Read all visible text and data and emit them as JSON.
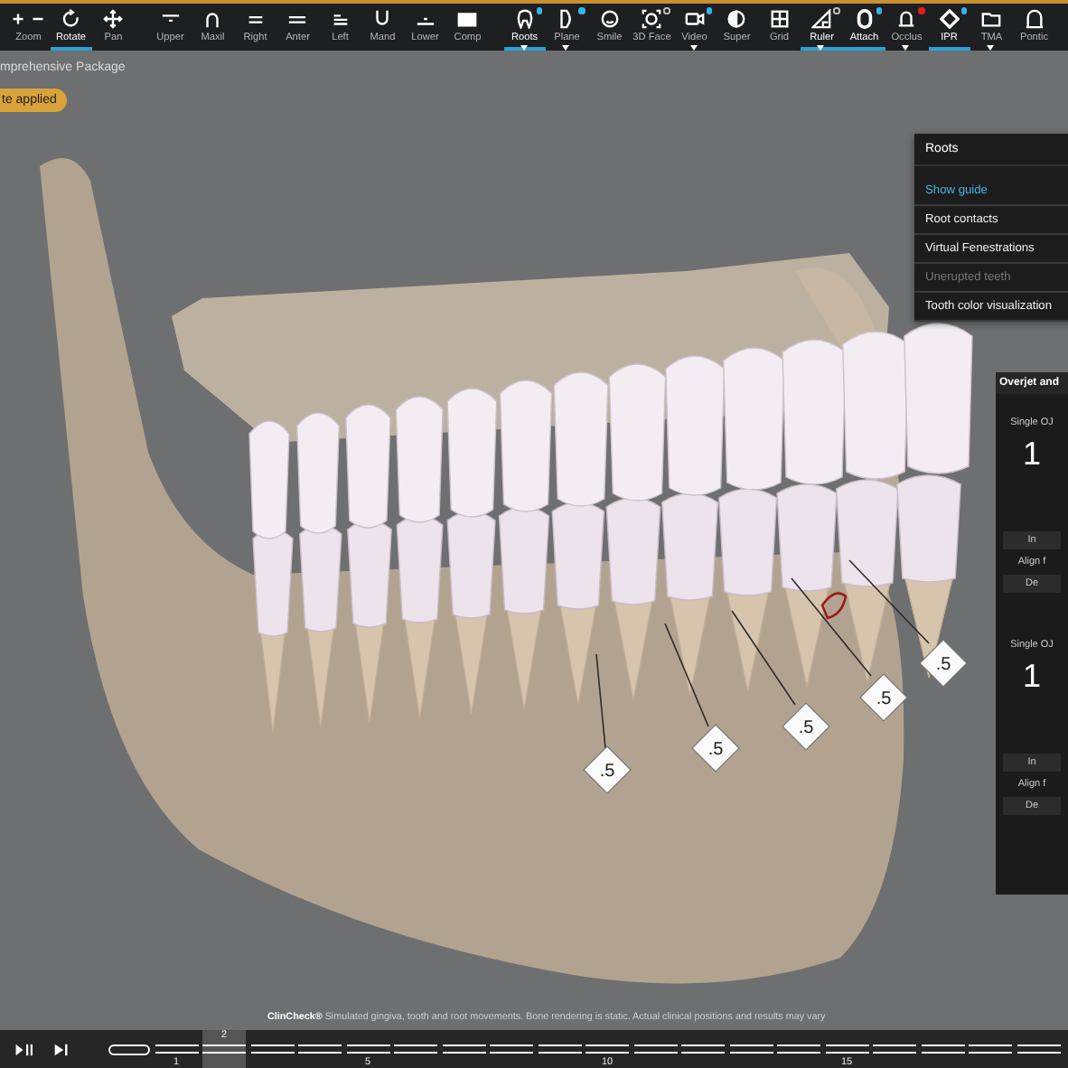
{
  "toolbar": {
    "groups": [
      [
        {
          "label": "Zoom",
          "selected": false
        },
        {
          "label": "Rotate",
          "selected": true
        },
        {
          "label": "Pan",
          "selected": false
        }
      ],
      [
        {
          "label": "Upper",
          "selected": false
        },
        {
          "label": "Maxil",
          "selected": false
        },
        {
          "label": "Right",
          "selected": false
        },
        {
          "label": "Anter",
          "selected": false
        },
        {
          "label": "Left",
          "selected": false
        },
        {
          "label": "Mand",
          "selected": false
        },
        {
          "label": "Lower",
          "selected": false
        },
        {
          "label": "Comp",
          "selected": false
        }
      ],
      [
        {
          "label": "Roots",
          "selected": true,
          "color": "#35b4e8",
          "hollow": false,
          "menu": true
        },
        {
          "label": "Plane",
          "selected": false,
          "color": "#35b4e8",
          "hollow": false,
          "menu": true
        },
        {
          "label": "Smile",
          "selected": false
        },
        {
          "label": "3D Face",
          "selected": false,
          "color": "#bbbbbb",
          "hollow": true
        },
        {
          "label": "Video",
          "selected": false,
          "color": "#35b4e8",
          "hollow": false,
          "menu": true
        },
        {
          "label": "Super",
          "selected": false
        },
        {
          "label": "Grid",
          "selected": false
        },
        {
          "label": "Ruler",
          "selected": true,
          "color": "#bbbbbb",
          "hollow": true,
          "menu": true
        },
        {
          "label": "Attach",
          "selected": true,
          "color": "#35b4e8",
          "hollow": false
        },
        {
          "label": "Occlus",
          "selected": false,
          "color": "#e02020",
          "hollow": false,
          "menu": true
        },
        {
          "label": "IPR",
          "selected": true,
          "color": "#35b4e8",
          "hollow": false
        },
        {
          "label": "TMA",
          "selected": false,
          "menu": true
        },
        {
          "label": "Pontic",
          "selected": false
        }
      ]
    ]
  },
  "header": {
    "title": "mprehensive Package",
    "badge": "te applied"
  },
  "ipr_markers": [
    ".5",
    ".5",
    ".5",
    ".5",
    ".5"
  ],
  "roots_menu": {
    "title": "Roots",
    "items": [
      {
        "label": "Show guide",
        "active": true,
        "disabled": false
      },
      {
        "label": "Root contacts",
        "active": false,
        "disabled": false
      },
      {
        "label": "Virtual Fenestrations",
        "active": false,
        "disabled": false
      },
      {
        "label": "Unerupted teeth",
        "active": false,
        "disabled": true
      },
      {
        "label": "Tooth color visualization",
        "active": false,
        "disabled": false
      }
    ]
  },
  "overjet_panel": {
    "title": "Overjet and",
    "sections": [
      {
        "label": "Single OJ",
        "value": "1",
        "button": "In",
        "note": "Align f",
        "button_2": "De"
      },
      {
        "label": "Single OJ",
        "value": "1",
        "button": "In",
        "note": "Align f",
        "button_2": "De"
      }
    ]
  },
  "disclaimer": "**ClinCheck®** Simulated gingiva, tooth and root movements. Bone rendering is static. Actual clinical positions and results may vary",
  "timeline": {
    "stages": [
      {
        "kind": "start",
        "selected": false
      },
      {
        "kind": "step",
        "selected": false,
        "tick": "1"
      },
      {
        "kind": "step",
        "selected": true,
        "top_label": "2"
      },
      {
        "kind": "step",
        "selected": false
      },
      {
        "kind": "step",
        "selected": false
      },
      {
        "kind": "step",
        "selected": false,
        "tick": "5"
      },
      {
        "kind": "step",
        "selected": false
      },
      {
        "kind": "step",
        "selected": false
      },
      {
        "kind": "step",
        "selected": false
      },
      {
        "kind": "step",
        "selected": false
      },
      {
        "kind": "step",
        "selected": false,
        "tick": "10"
      },
      {
        "kind": "step",
        "selected": false
      },
      {
        "kind": "step",
        "selected": false
      },
      {
        "kind": "step",
        "selected": false
      },
      {
        "kind": "step",
        "selected": false
      },
      {
        "kind": "step",
        "selected": false,
        "tick": "15"
      },
      {
        "kind": "step",
        "selected": false
      },
      {
        "kind": "step",
        "selected": false
      },
      {
        "kind": "step",
        "selected": false
      },
      {
        "kind": "step",
        "selected": false
      }
    ]
  }
}
